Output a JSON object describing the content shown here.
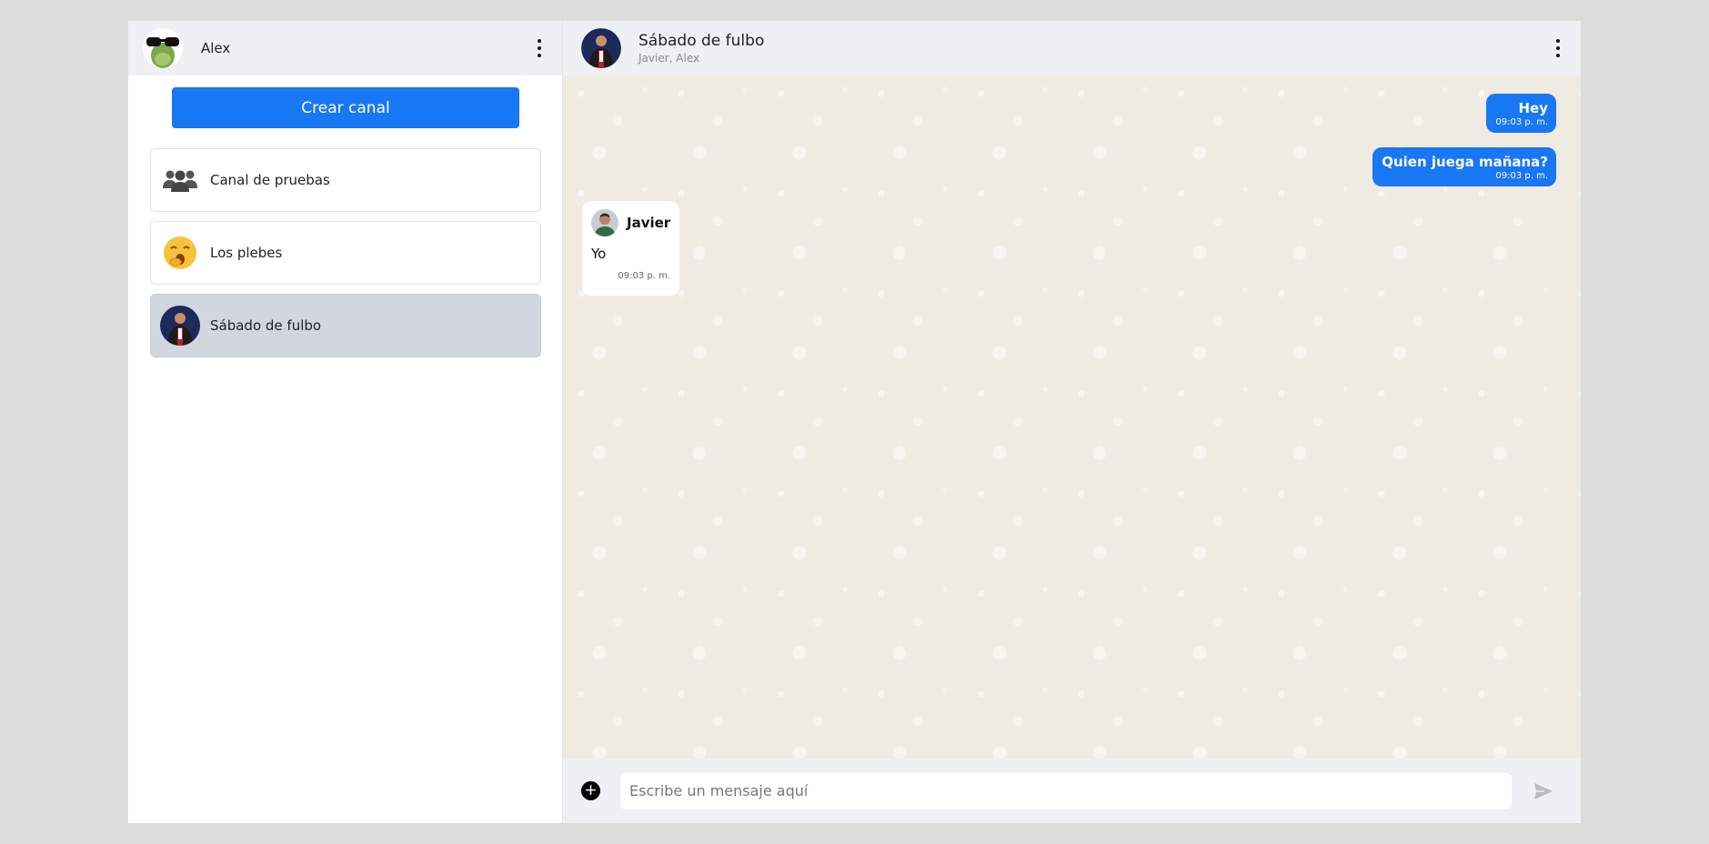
{
  "sidebar": {
    "user_name": "Alex",
    "create_button_label": "Crear canal",
    "channels": [
      {
        "label": "Canal de pruebas",
        "icon": "group-icon"
      },
      {
        "label": "Los plebes",
        "icon": "yawning-emoji-icon"
      },
      {
        "label": "Sábado de fulbo",
        "icon": "channel-avatar",
        "active": true
      }
    ]
  },
  "chat": {
    "title": "Sábado de fulbo",
    "members": "Javier, Alex",
    "messages": [
      {
        "direction": "out",
        "text": "Hey",
        "time": "09:03 p. m."
      },
      {
        "direction": "out",
        "text": "Quien juega mañana?",
        "time": "09:03 p. m."
      },
      {
        "direction": "in",
        "sender": "Javier",
        "text": "Yo",
        "time": "09:03 p. m."
      }
    ],
    "input_placeholder": "Escribe un mensaje aquí"
  },
  "colors": {
    "accent": "#1877f2",
    "header_bg": "#eff0f4",
    "chat_bg": "#efeae2",
    "active_channel_bg": "#d2d6de"
  }
}
